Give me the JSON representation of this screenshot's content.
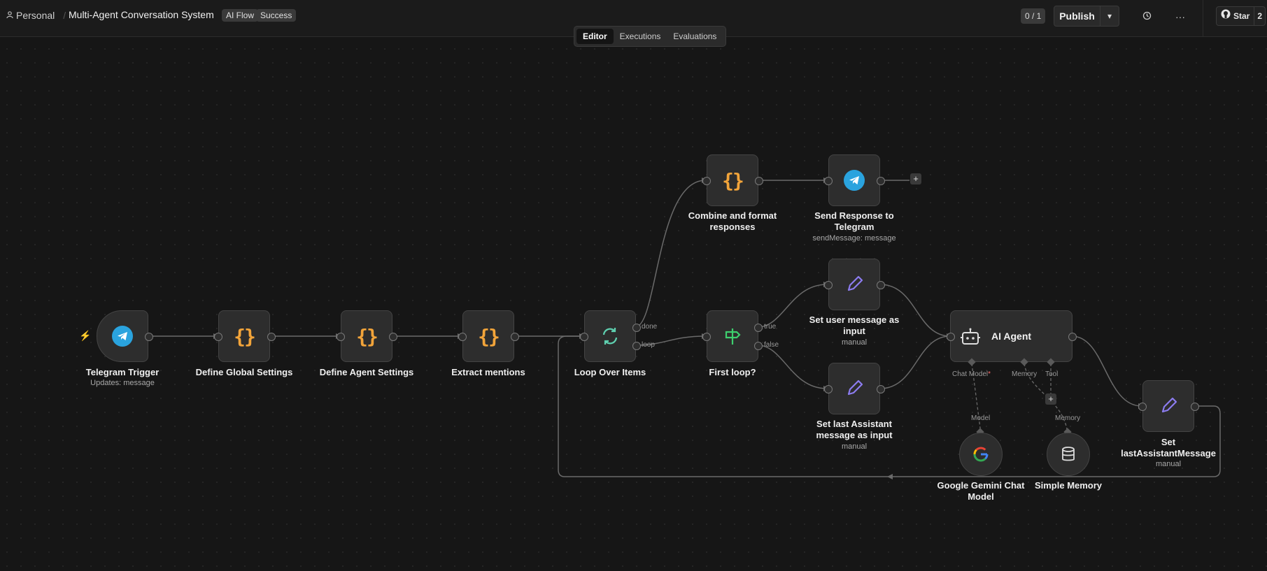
{
  "header": {
    "breadcrumb_home": "Personal",
    "breadcrumb_sep": "/",
    "workflow_title": "Multi-Agent Conversation System",
    "tags": [
      "AI Flow",
      "Success"
    ],
    "counter": "0 / 1",
    "publish_label": "Publish",
    "more_label": "···",
    "github_star_label": "Star",
    "github_star_count": "2"
  },
  "tabs": [
    "Editor",
    "Executions",
    "Evaluations"
  ],
  "active_tab": "Editor",
  "nodes": {
    "telegram_trigger": {
      "label": "Telegram Trigger",
      "sub": "Updates: message"
    },
    "define_global": {
      "label": "Define Global Settings"
    },
    "define_agent": {
      "label": "Define Agent Settings"
    },
    "extract_mentions": {
      "label": "Extract mentions"
    },
    "loop_over_items": {
      "label": "Loop Over Items",
      "out_done": "done",
      "out_loop": "loop"
    },
    "first_loop": {
      "label": "First loop?",
      "out_true": "true",
      "out_false": "false"
    },
    "combine": {
      "label_line1": "Combine and format",
      "label_line2": "responses"
    },
    "send_response": {
      "label_line1": "Send Response to",
      "label_line2": "Telegram",
      "sub": "sendMessage: message"
    },
    "set_user_msg": {
      "label_line1": "Set user message as",
      "label_line2": "input",
      "sub": "manual"
    },
    "set_last_assistant": {
      "label_line1": "Set last Assistant",
      "label_line2": "message as input",
      "sub": "manual"
    },
    "ai_agent": {
      "label": "AI Agent",
      "in_chat_model": "Chat Model",
      "in_memory": "Memory",
      "in_tool": "Tool"
    },
    "set_last_assistant_message": {
      "label_line1": "Set",
      "label_line2": "lastAssistantMessage",
      "sub": "manual"
    },
    "gemini": {
      "label_line1": "Google Gemini Chat",
      "label_line2": "Model",
      "port": "Model"
    },
    "simple_memory": {
      "label": "Simple Memory",
      "port": "Memory"
    }
  },
  "colors": {
    "accent_braces": "#f2a43a",
    "telegram": "#2aa3de",
    "edit_pen": "#8c7cf0",
    "loop": "#5fd0b0",
    "router": "#3ecf6e",
    "required": "#ff6b6b"
  }
}
